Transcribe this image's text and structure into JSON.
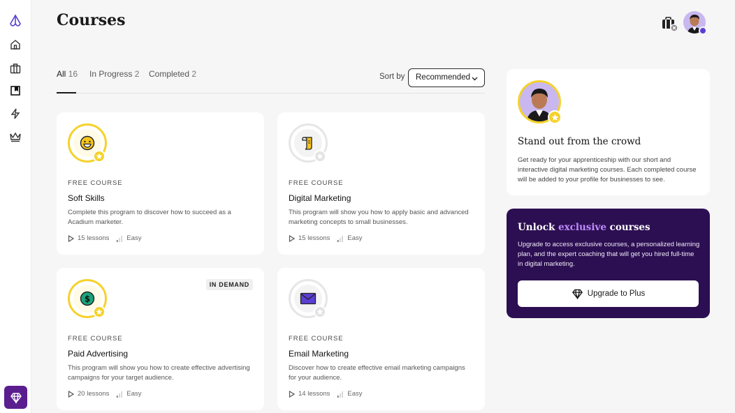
{
  "page": {
    "title": "Courses"
  },
  "sidebar": {
    "items": [
      {
        "icon": "logo-icon"
      },
      {
        "icon": "home-icon"
      },
      {
        "icon": "briefcase-icon"
      },
      {
        "icon": "bookmark-icon"
      },
      {
        "icon": "lightning-icon"
      },
      {
        "icon": "crown-icon"
      }
    ],
    "premium_icon": "diamond-icon"
  },
  "tabs": [
    {
      "label": "All",
      "count": "16"
    },
    {
      "label": "In Progress",
      "count": "2"
    },
    {
      "label": "Completed",
      "count": "2"
    }
  ],
  "sort": {
    "label": "Sort by",
    "value": "Recommended"
  },
  "courses": [
    {
      "label": "FREE COURSE",
      "title": "Soft Skills",
      "description": "Complete this program to discover how to succeed as a Acadium marketer.",
      "lessons": "15 lessons",
      "difficulty": "Easy",
      "icon": "smiley-icon",
      "tag": ""
    },
    {
      "label": "FREE COURSE",
      "title": "Digital Marketing",
      "description": "This program will show you how to apply basic and advanced marketing concepts to small businesses.",
      "lessons": "15 lessons",
      "difficulty": "Easy",
      "icon": "scroll-icon",
      "tag": ""
    },
    {
      "label": "FREE COURSE",
      "title": "Paid Advertising",
      "description": "This program will show you how to create effective advertising campaigns for your target audience.",
      "lessons": "20 lessons",
      "difficulty": "Easy",
      "icon": "dollar-coin-icon",
      "tag": "IN DEMAND"
    },
    {
      "label": "FREE COURSE",
      "title": "Email Marketing",
      "description": "Discover how to create effective email marketing campaigns for your audience.",
      "lessons": "14 lessons",
      "difficulty": "Easy",
      "icon": "envelope-icon",
      "tag": ""
    }
  ],
  "crowd_panel": {
    "title": "Stand out from the crowd",
    "text": "Get ready for your apprenticeship with our short and interactive digital marketing courses. Each  completed course will be added to your profile for businesses to see."
  },
  "unlock_panel": {
    "title_prefix": "Unlock ",
    "title_highlight": "exclusive",
    "title_suffix": " courses",
    "text": "Upgrade to access exclusive courses, a personalized learning plan, and the expert coaching that will get you hired full-time in digital marketing.",
    "button": "Upgrade to Plus"
  },
  "colors": {
    "accent_yellow": "#f5d22a",
    "premium_purple": "#2c0f52",
    "highlight_purple": "#c08bff"
  }
}
